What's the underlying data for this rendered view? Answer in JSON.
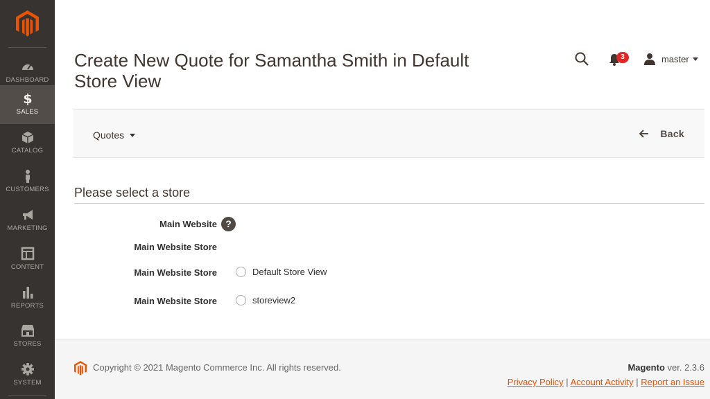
{
  "sidebar": {
    "items": [
      {
        "label": "DASHBOARD",
        "icon": "dashboard-icon"
      },
      {
        "label": "SALES",
        "icon": "dollar-icon",
        "active": true
      },
      {
        "label": "CATALOG",
        "icon": "cube-icon"
      },
      {
        "label": "CUSTOMERS",
        "icon": "person-icon"
      },
      {
        "label": "MARKETING",
        "icon": "megaphone-icon"
      },
      {
        "label": "CONTENT",
        "icon": "layout-icon"
      },
      {
        "label": "REPORTS",
        "icon": "bar-chart-icon"
      },
      {
        "label": "STORES",
        "icon": "storefront-icon"
      },
      {
        "label": "SYSTEM",
        "icon": "gear-icon"
      }
    ]
  },
  "header": {
    "title": "Create New Quote for Samantha Smith in Default Store View",
    "notifications_count": "3",
    "user_name": "master"
  },
  "actions": {
    "switcher_label": "Quotes",
    "back_label": "Back"
  },
  "store_select": {
    "title": "Please select a store",
    "website_label": "Main Website",
    "help_glyph": "?",
    "group_label": "Main Website Store",
    "options": [
      {
        "group": "Main Website Store",
        "label": "Default Store View"
      },
      {
        "group": "Main Website Store",
        "label": "storeview2"
      }
    ]
  },
  "footer": {
    "copyright": "Copyright © 2021 Magento Commerce Inc. All rights reserved.",
    "brand": "Magento",
    "version": " ver. 2.3.6",
    "links": [
      "Privacy Policy",
      " Account Activity",
      "Report an Issue"
    ],
    "separator": " | "
  },
  "colors": {
    "sidebar_bg": "#373330",
    "sidebar_active": "#524d49",
    "brand_orange": "#eb5202",
    "badge_red": "#e22626"
  }
}
